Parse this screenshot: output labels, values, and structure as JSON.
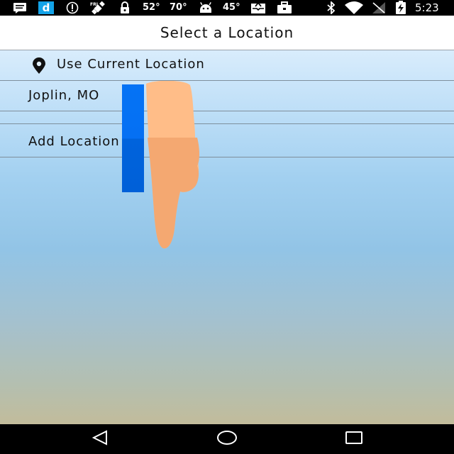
{
  "status_bar": {
    "weather_temp_1": "52°",
    "weather_temp_2": "70°",
    "weather_temp_3": "45°",
    "time": "5:23",
    "icons": [
      "message-icon",
      "d-app-icon",
      "info-icon",
      "satellite-icon",
      "lock-icon",
      "android-icon",
      "inbox-icon",
      "briefcase-icon",
      "bluetooth-icon",
      "wifi-icon",
      "no-signal-icon",
      "battery-charging-icon"
    ]
  },
  "header": {
    "title": "Select a Location"
  },
  "locations": {
    "current_label": "Use Current Location",
    "saved": [
      "Joplin, MO"
    ],
    "add_label": "Add Location"
  },
  "nav_bar": {
    "buttons": [
      "back-icon",
      "home-icon",
      "recents-icon"
    ]
  },
  "colors": {
    "drag_handle": "#0573f5",
    "finger": "#ffbd88",
    "title_bar_bg": "#ffffff",
    "status_bar_bg": "#000000"
  }
}
